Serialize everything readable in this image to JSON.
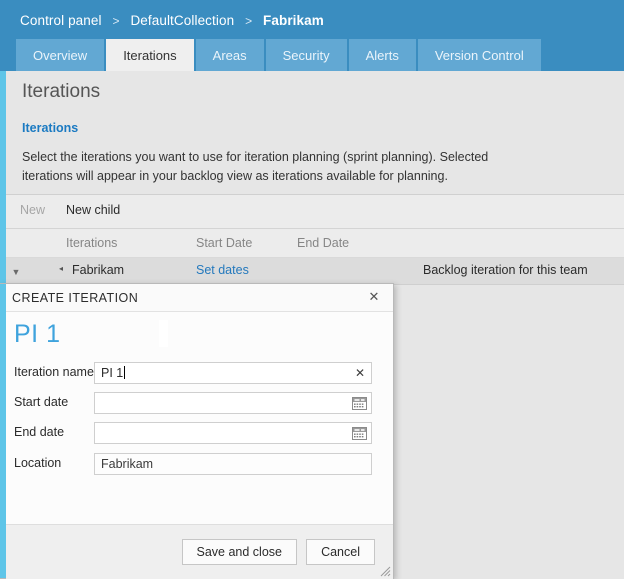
{
  "header": {
    "breadcrumb": {
      "items": [
        "Control panel",
        "DefaultCollection",
        "Fabrikam"
      ],
      "separator": ">"
    },
    "tabs": [
      {
        "label": "Overview",
        "active": false
      },
      {
        "label": "Iterations",
        "active": true
      },
      {
        "label": "Areas",
        "active": false
      },
      {
        "label": "Security",
        "active": false
      },
      {
        "label": "Alerts",
        "active": false
      },
      {
        "label": "Version Control",
        "active": false
      }
    ]
  },
  "page": {
    "title": "Iterations",
    "section_title": "Iterations",
    "description": "Select the iterations you want to use for iteration planning (sprint planning). Selected iterations will appear in your backlog view as iterations available for planning."
  },
  "toolbar": {
    "new_label": "New",
    "new_child_label": "New child"
  },
  "grid": {
    "columns": [
      "Iterations",
      "Start Date",
      "End Date"
    ],
    "rows": [
      {
        "name": "Fabrikam",
        "dates_link": "Set dates",
        "description": "Backlog iteration for this team",
        "expander_icon": "chevron-down-icon",
        "tree_icon": "tree-collapse-icon"
      }
    ]
  },
  "dialog": {
    "title": "CREATE ITERATION",
    "close_icon": "close-icon",
    "heading": "PI 1",
    "fields": [
      {
        "label": "Iteration name",
        "value": "PI 1",
        "placeholder": "",
        "readonly": false,
        "clear_icon": "clear-x-icon",
        "has_caret": true
      },
      {
        "label": "Start date",
        "value": "",
        "placeholder": "",
        "readonly": false,
        "calendar_icon": "calendar-icon"
      },
      {
        "label": "End date",
        "value": "",
        "placeholder": "",
        "readonly": false,
        "calendar_icon": "calendar-icon"
      },
      {
        "label": "Location",
        "value": "Fabrikam",
        "placeholder": "",
        "readonly": true
      }
    ],
    "buttons": {
      "save_label": "Save and close",
      "cancel_label": "Cancel"
    },
    "resize_icon": "resize-grip-icon"
  },
  "colors": {
    "header_blue": "#3a8dc0",
    "tab_blue": "#62a8d3",
    "accent_cyan": "#5ec5e8",
    "link_blue": "#2479bd",
    "heading_blue": "#3fa3dd",
    "section_blue": "#1b7ac2",
    "page_bg": "#e6e6e6"
  }
}
